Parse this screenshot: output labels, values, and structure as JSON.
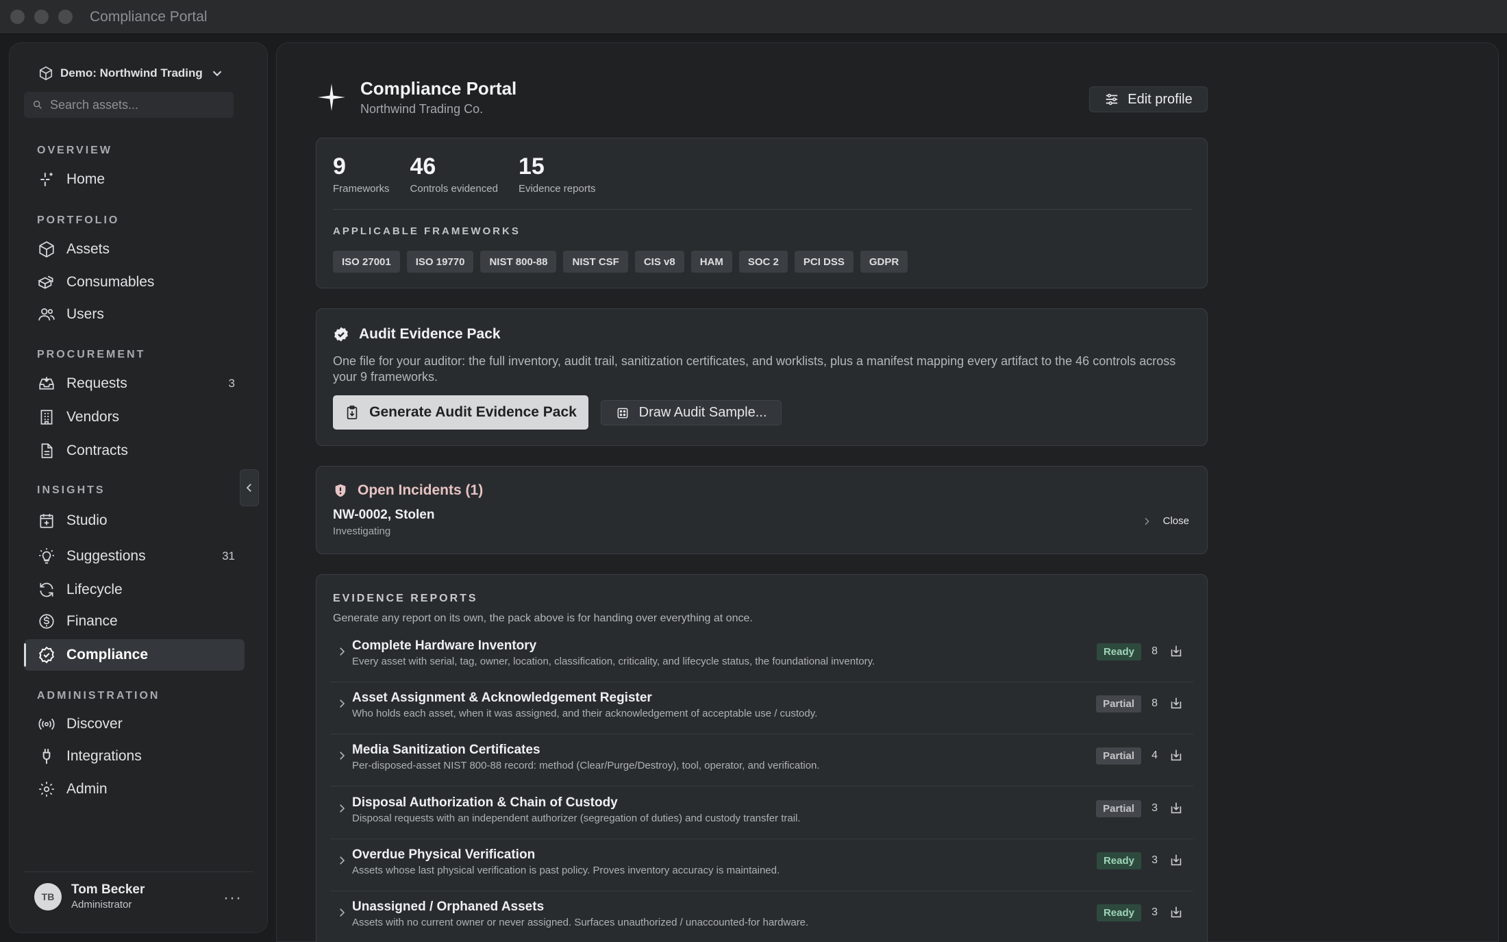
{
  "window": {
    "title": "Compliance Portal"
  },
  "sidebar": {
    "org": "Demo: Northwind Trading",
    "search_placeholder": "Search assets...",
    "sections": {
      "overview": "OVERVIEW",
      "portfolio": "PORTFOLIO",
      "procurement": "PROCUREMENT",
      "insights": "INSIGHTS",
      "administration": "ADMINISTRATION"
    },
    "items": {
      "home": "Home",
      "assets": "Assets",
      "consumables": "Consumables",
      "users": "Users",
      "requests": "Requests",
      "requests_badge": "3",
      "vendors": "Vendors",
      "contracts": "Contracts",
      "studio": "Studio",
      "suggestions": "Suggestions",
      "suggestions_badge": "31",
      "lifecycle": "Lifecycle",
      "finance": "Finance",
      "compliance": "Compliance",
      "discover": "Discover",
      "integrations": "Integrations",
      "admin": "Admin"
    },
    "user": {
      "initials": "TB",
      "name": "Tom Becker",
      "role": "Administrator",
      "more": "···"
    }
  },
  "header": {
    "title": "Compliance Portal",
    "subtitle": "Northwind Trading Co.",
    "edit_label": "Edit profile"
  },
  "summary": {
    "stats": [
      {
        "value": "9",
        "label": "Frameworks"
      },
      {
        "value": "46",
        "label": "Controls evidenced"
      },
      {
        "value": "15",
        "label": "Evidence reports"
      }
    ],
    "frameworks_title": "APPLICABLE FRAMEWORKS",
    "frameworks": [
      "ISO 27001",
      "ISO 19770",
      "NIST 800-88",
      "NIST CSF",
      "CIS v8",
      "HAM",
      "SOC 2",
      "PCI DSS",
      "GDPR"
    ]
  },
  "pack": {
    "title": "Audit Evidence Pack",
    "description": "One file for your auditor: the full inventory, audit trail, sanitization certificates, and worklists, plus a manifest mapping every artifact to the 46 controls across your 9 frameworks.",
    "generate_label": "Generate Audit Evidence Pack",
    "sample_label": "Draw Audit Sample..."
  },
  "incidents": {
    "title": "Open Incidents (1)",
    "item_title": "NW-0002, Stolen",
    "item_status": "Investigating",
    "close_label": "Close"
  },
  "reports": {
    "title": "EVIDENCE REPORTS",
    "subtitle": "Generate any report on its own, the pack above is for handing over everything at once.",
    "items": [
      {
        "title": "Complete Hardware Inventory",
        "desc": "Every asset with serial, tag, owner, location, classification, criticality, and lifecycle status, the foundational inventory.",
        "status": "Ready",
        "count": "8"
      },
      {
        "title": "Asset Assignment & Acknowledgement Register",
        "desc": "Who holds each asset, when it was assigned, and their acknowledgement of acceptable use / custody.",
        "status": "Partial",
        "count": "8"
      },
      {
        "title": "Media Sanitization Certificates",
        "desc": "Per-disposed-asset NIST 800-88 record: method (Clear/Purge/Destroy), tool, operator, and verification.",
        "status": "Partial",
        "count": "4"
      },
      {
        "title": "Disposal Authorization & Chain of Custody",
        "desc": "Disposal requests with an independent authorizer (segregation of duties) and custody transfer trail.",
        "status": "Partial",
        "count": "3"
      },
      {
        "title": "Overdue Physical Verification",
        "desc": "Assets whose last physical verification is past policy. Proves inventory accuracy is maintained.",
        "status": "Ready",
        "count": "3"
      },
      {
        "title": "Unassigned / Orphaned Assets",
        "desc": "Assets with no current owner or never assigned. Surfaces unauthorized / unaccounted-for hardware.",
        "status": "Ready",
        "count": "3"
      }
    ]
  }
}
